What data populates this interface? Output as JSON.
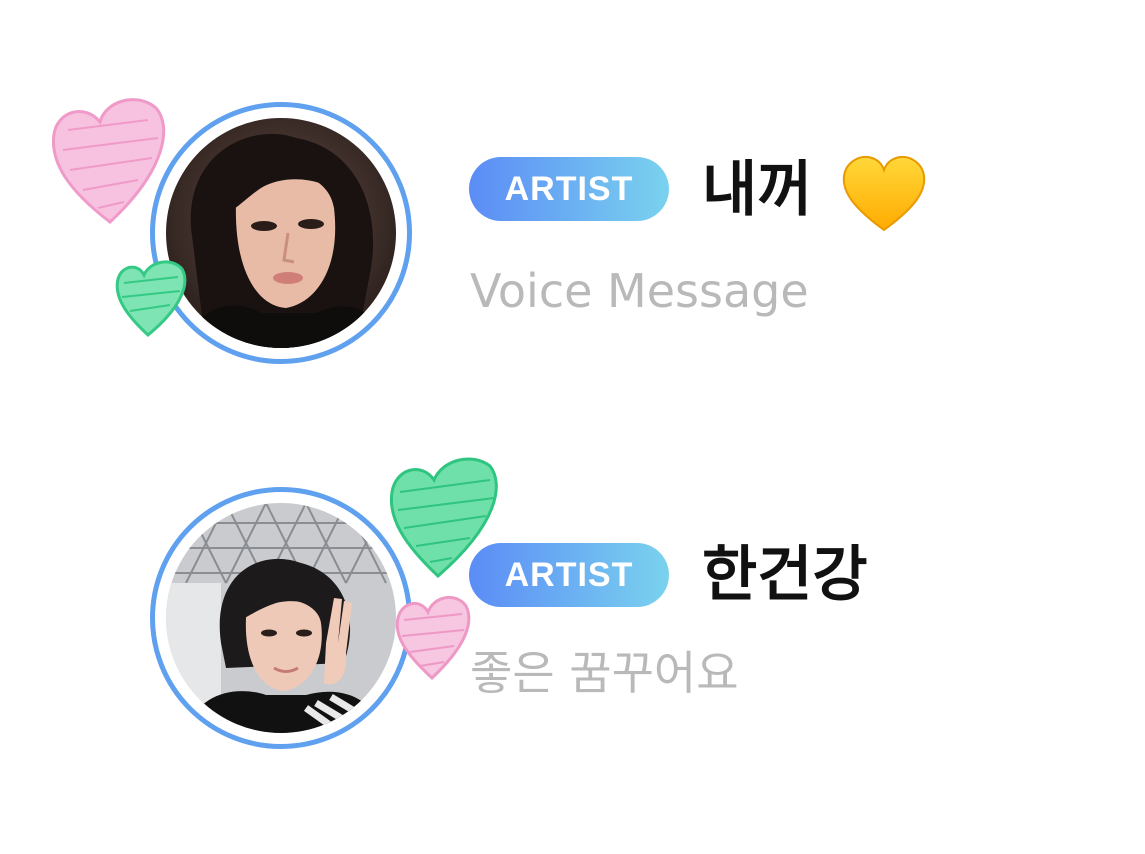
{
  "colors": {
    "ring": "#5fa0ef",
    "badge_gradient_start": "#5b8cf6",
    "badge_gradient_end": "#7ad2ee",
    "name_text": "#111111",
    "preview_text": "#b9b9b9",
    "heart_pink": "#f3a7cf",
    "heart_green": "#42d58f",
    "heart_emoji": "#ffc21a"
  },
  "chats": [
    {
      "badge": "ARTIST",
      "name": "내꺼",
      "name_emoji": "yellow-heart-icon",
      "preview": "Voice Message"
    },
    {
      "badge": "ARTIST",
      "name": "한건강",
      "preview": "좋은 꿈꾸어요"
    }
  ]
}
